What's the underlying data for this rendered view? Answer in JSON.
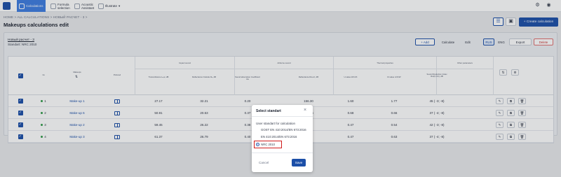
{
  "topbar": {
    "nav": [
      {
        "label": "Calculations",
        "icon": "calculator-icon",
        "active": true
      },
      {
        "label": "Formula selection",
        "icon": "formula-icon",
        "active": false
      },
      {
        "label": "Acoustic Assistant",
        "icon": "acoustic-icon",
        "active": false
      },
      {
        "label": "Illustrate",
        "icon": "illustrate-icon",
        "active": false
      }
    ]
  },
  "breadcrumb": "HOME > ALL CALCULATIONS > НОВЫЙ РАСЧЕТ - 3 >",
  "page_title": "Makeups calculations edit",
  "create_button": "+ Create calculation",
  "pack": {
    "name": "Новый расчет - 3",
    "standard": "Standart: NRC 2010"
  },
  "toolbar": {
    "add": "+ Add",
    "calculate": "Calculate",
    "edit": "Edit",
    "rus": "RUS",
    "eng": "ENG",
    "export": "Export",
    "delete": "Delete"
  },
  "table": {
    "group_headers": [
      "Impact sound",
      "Airborne sound",
      "Thermal properties",
      "Other parameters"
    ],
    "columns": [
      "№",
      "Makeups",
      "Pictured",
      "Transmittance Lₙ,w, dB",
      "Reflectance Outside Rₐ, dB",
      "Sound absorption Coefficient αw",
      "Reflectance Rw+C, dB",
      "U-value W/m²K",
      "R-value m²K/W",
      "Sound Reduction Index Rw(C;Ctr), dB"
    ],
    "rows": [
      {
        "num": "1",
        "name": "Make-up 1",
        "v1": "27.17",
        "v2": "32.21",
        "v3": "0.20",
        "v4": "156.30",
        "v5": "1.60",
        "v6": "1.77",
        "v7": "45 ( -3; -8)"
      },
      {
        "num": "2",
        "name": "Make-up 6",
        "v1": "50.91",
        "v2": "20.53",
        "v3": "0.37",
        "v4": "271.56",
        "v5": "0.68",
        "v6": "0.66",
        "v7": "37 ( -4; -8)"
      },
      {
        "num": "3",
        "name": "Make-up 2",
        "v1": "59.45",
        "v2": "26.22",
        "v3": "0.38",
        "v4": "",
        "v5": "0.47",
        "v6": "0.54",
        "v7": "42 ( -3; -8)"
      },
      {
        "num": "4",
        "name": "Make-up 3",
        "v1": "61.37",
        "v2": "26.79",
        "v3": "0.40",
        "v4": "",
        "v5": "0.47",
        "v6": "0.63",
        "v7": "37 ( -4; -8)"
      }
    ]
  },
  "modal": {
    "title": "Select standart",
    "label": "User standart for calculation",
    "options": [
      "GOST EN 410:2014/EN 673:2016",
      "EN 410:2014/EN 673:2016",
      "NRC 2010"
    ],
    "selected": "NRC 2010",
    "cancel": "Cancel",
    "save": "Save"
  },
  "colors": {
    "accent": "#1c4fa8",
    "highlight": "#d01b1b",
    "status_green": "#2f9a48"
  }
}
